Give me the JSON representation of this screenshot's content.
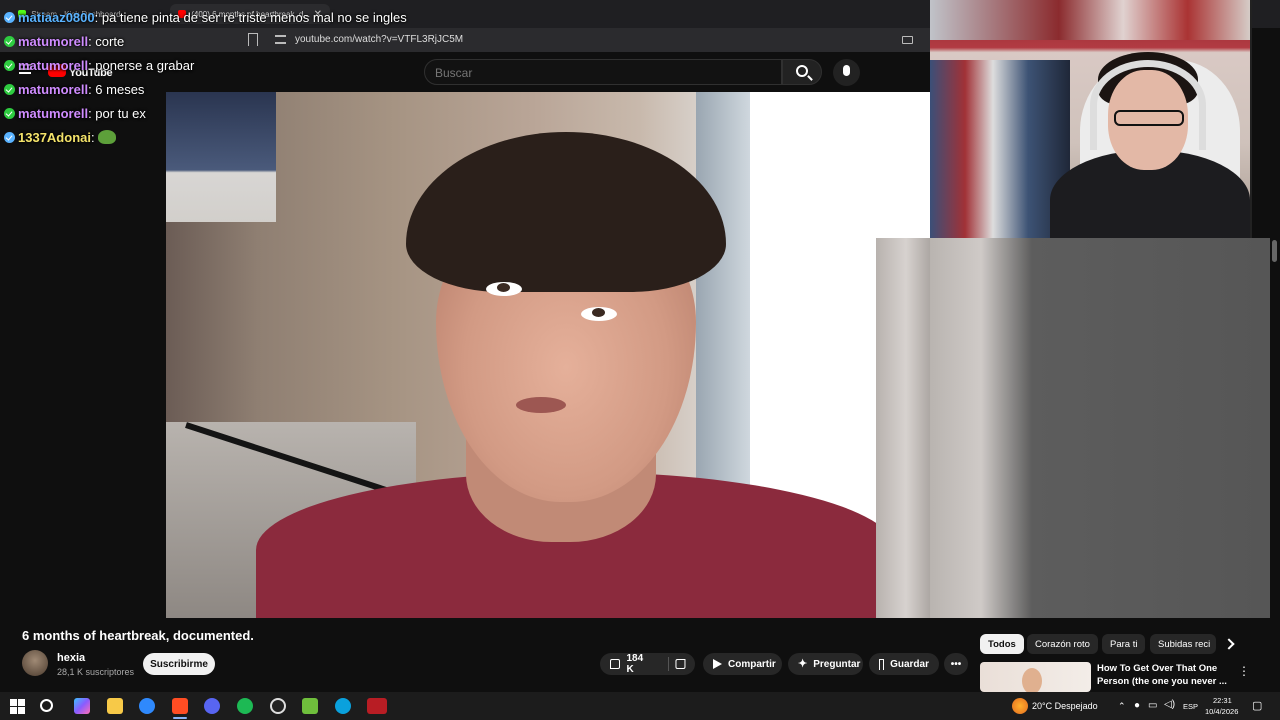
{
  "browser": {
    "tabs": [
      {
        "label": "Stream - Kick Dashboard"
      },
      {
        "label": "(400) 6 months of heartbreak, d..."
      }
    ],
    "url": "youtube.com/watch?v=VTFL3RjJC5M"
  },
  "youtube": {
    "logo_text": "YouTube",
    "search_placeholder": "Buscar",
    "video": {
      "title": "6 months of heartbreak, documented.",
      "channel": "hexia",
      "subscribers": "28,1 K suscriptores",
      "subscribe_label": "Suscribirme",
      "likes": "184 K",
      "share_label": "Compartir",
      "ask_label": "Preguntar",
      "save_label": "Guardar",
      "more_label": "•••"
    },
    "chips": [
      {
        "label": "Todos",
        "active": true
      },
      {
        "label": "Corazón roto"
      },
      {
        "label": "Para ti"
      },
      {
        "label": "Subidas reci"
      }
    ],
    "recommendation": {
      "title": "How To Get Over That One Person (the one you never ..."
    }
  },
  "chat": {
    "messages": [
      {
        "user": "matiaaz0800",
        "text": ": pa tiene pinta de ser re triste menos mal no se ingles"
      },
      {
        "user": "matumorell",
        "text": ": corte"
      },
      {
        "user": "matumorell",
        "text": ": ponerse a grabar"
      },
      {
        "user": "matumorell",
        "text": ": 6 meses"
      },
      {
        "user": "matumorell",
        "text": ": por tu ex"
      },
      {
        "user": "1337Adonai",
        "text": ":"
      }
    ]
  },
  "taskbar": {
    "weather": "20°C  Despejado",
    "language": "ESP",
    "time": "22:31",
    "date": "10/4/2026"
  },
  "colors": {
    "background": "#0f0f0f",
    "youtube_red": "#ff0000",
    "chat_username": "#cf8cff",
    "chat_username_alt": "#f4e36a"
  }
}
